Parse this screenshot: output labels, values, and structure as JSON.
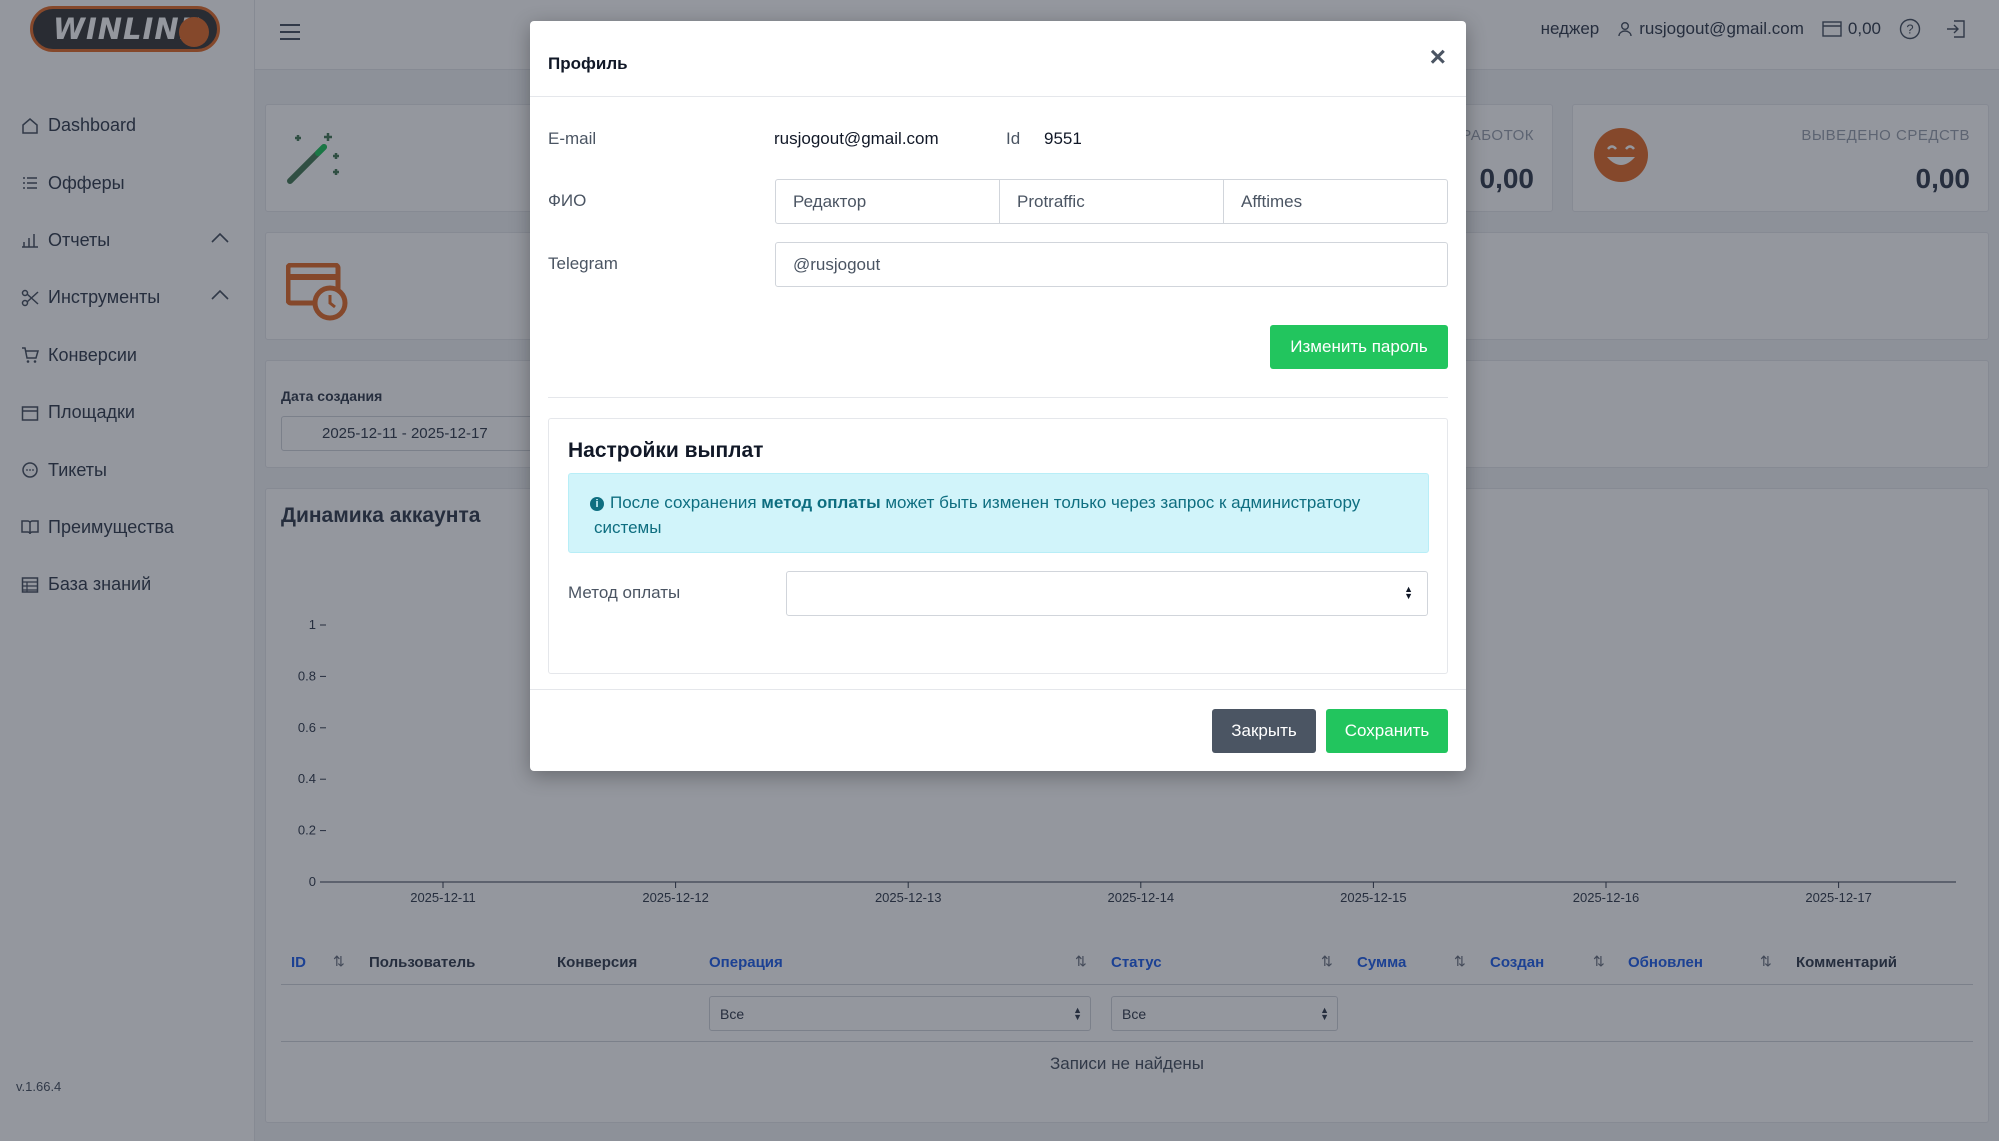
{
  "brand": {
    "logo_text": "WINLINE",
    "accent": "#e4702f"
  },
  "sidebar": {
    "items": [
      {
        "label": "Dashboard",
        "icon": "home-icon"
      },
      {
        "label": "Офферы",
        "icon": "list-icon"
      },
      {
        "label": "Отчеты",
        "icon": "bar-chart-icon",
        "expandable": true
      },
      {
        "label": "Инструменты",
        "icon": "scissors-icon",
        "expandable": true
      },
      {
        "label": "Конверсии",
        "icon": "cart-icon"
      },
      {
        "label": "Площадки",
        "icon": "calendar-icon"
      },
      {
        "label": "Тикеты",
        "icon": "chat-icon"
      },
      {
        "label": "Преимущества",
        "icon": "book-icon"
      },
      {
        "label": "База знаний",
        "icon": "table-icon"
      }
    ],
    "version": "v.1.66.4"
  },
  "topbar": {
    "manager_partial": "неджер",
    "user_email": "rusjogout@gmail.com",
    "balance": "0,00"
  },
  "stats": [
    {
      "label": "РАБОТОК",
      "value": "0,00"
    },
    {
      "label": "ВЫВЕДЕНО СРЕДСТВ",
      "value": "0,00"
    }
  ],
  "filters": {
    "created_label": "Дата создания",
    "date_range": "2025-12-11 - 2025-12-17"
  },
  "chart_section_title": "Динамика аккаунта",
  "chart_data": {
    "type": "line",
    "title": "",
    "x": [
      "2025-12-11",
      "2025-12-12",
      "2025-12-13",
      "2025-12-14",
      "2025-12-15",
      "2025-12-16",
      "2025-12-17"
    ],
    "series": [],
    "ylim": [
      0,
      1
    ],
    "yticks": [
      "0",
      "0.2",
      "0.4",
      "0.6",
      "0.8",
      "1"
    ],
    "grid": false
  },
  "table": {
    "columns": [
      {
        "label": "ID",
        "sortable": true,
        "link": true
      },
      {
        "label": "Пользователь",
        "sortable": false,
        "link": false
      },
      {
        "label": "Конверсия",
        "sortable": false,
        "link": false
      },
      {
        "label": "Операция",
        "sortable": true,
        "link": true
      },
      {
        "label": "Статус",
        "sortable": true,
        "link": true
      },
      {
        "label": "Сумма",
        "sortable": true,
        "link": true
      },
      {
        "label": "Создан",
        "sortable": true,
        "link": true
      },
      {
        "label": "Обновлен",
        "sortable": true,
        "link": true
      },
      {
        "label": "Комментарий",
        "sortable": false,
        "link": false
      }
    ],
    "operation_filter": "Все",
    "status_filter": "Все",
    "empty_text": "Записи не найдены"
  },
  "modal": {
    "title": "Профиль",
    "close_symbol": "×",
    "email_label": "E-mail",
    "email_value": "rusjogout@gmail.com",
    "id_label": "Id",
    "id_value": "9551",
    "fio_label": "ФИО",
    "fio_fields": [
      "Редактор",
      "Protraffic",
      "Afftimes"
    ],
    "telegram_label": "Telegram",
    "telegram_value": "@rusjogout",
    "change_password_button": "Изменить пароль",
    "payout": {
      "title": "Настройки выплат",
      "alert_prefix": "После сохранения ",
      "alert_bold": "метод оплаты",
      "alert_suffix": " может быть изменен только через запрос к администратору системы",
      "method_label": "Метод оплаты",
      "method_value": ""
    },
    "close_button": "Закрыть",
    "save_button": "Сохранить"
  }
}
